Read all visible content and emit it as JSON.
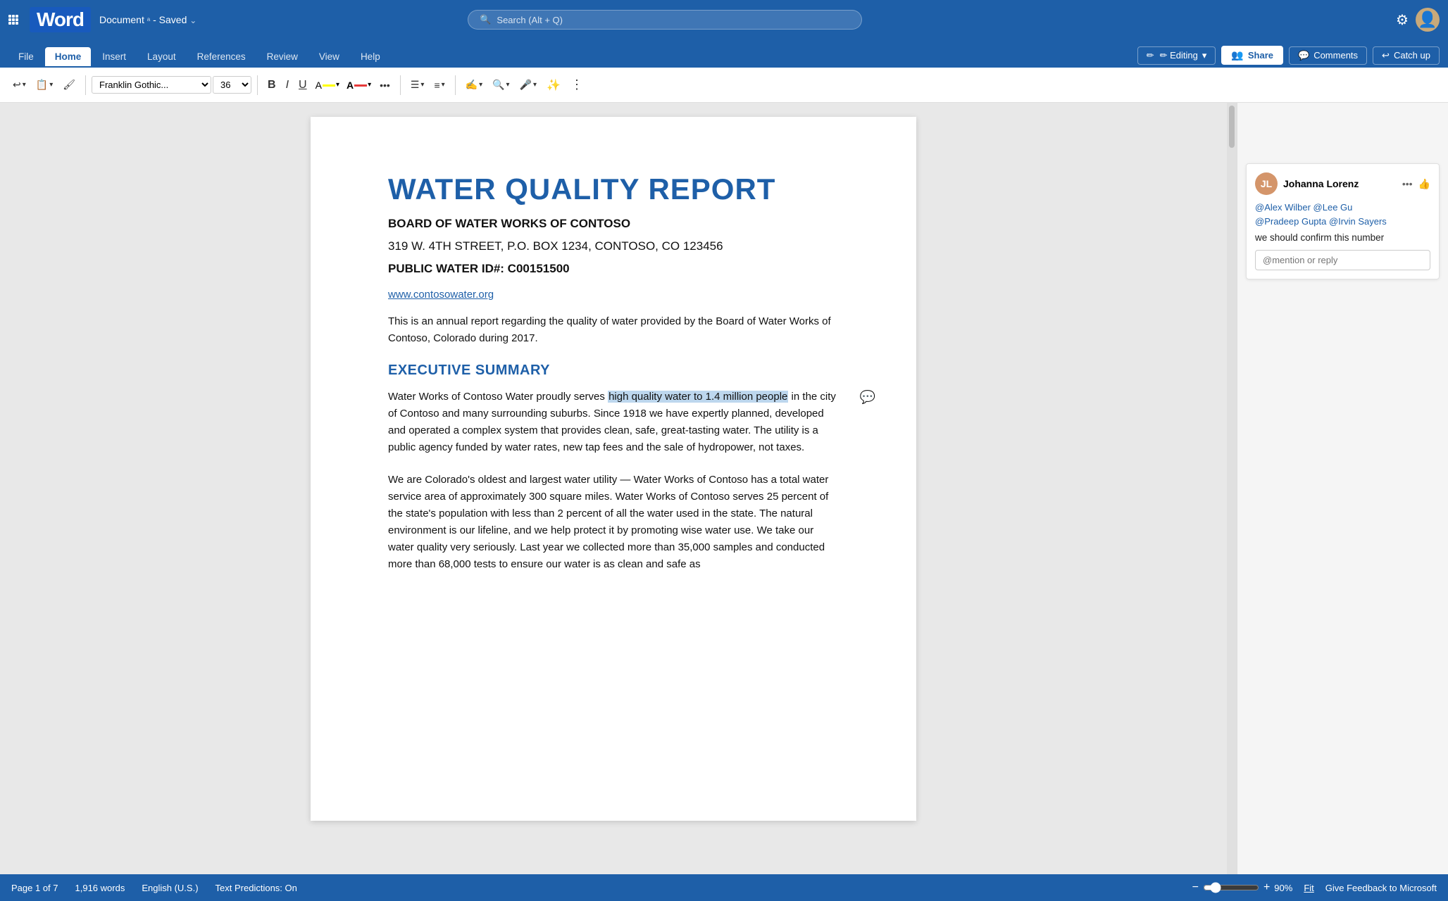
{
  "app": {
    "name": "Word",
    "logo_letter": "W"
  },
  "titlebar": {
    "document_name": "Document",
    "saved_status": "Saved",
    "search_placeholder": "Search (Alt + Q)"
  },
  "ribbon": {
    "tabs": [
      "File",
      "Home",
      "Insert",
      "Layout",
      "References",
      "Review",
      "View",
      "Help"
    ],
    "active_tab": "Home",
    "editing_label": "✏ Editing",
    "share_label": "Share",
    "comments_label": "Comments",
    "catchup_label": "Catch up"
  },
  "toolbar": {
    "undo_label": "↩",
    "clipboard_label": "📋",
    "font_name": "Franklin Gothic...",
    "font_size": "36",
    "bold": "B",
    "italic": "I",
    "underline": "U",
    "more_label": "•••",
    "bullets_label": "☰",
    "align_label": "≡",
    "editor_label": "✍",
    "search_label": "🔍",
    "dictate_label": "🎤",
    "copilot_label": "✨",
    "overflow_label": "•••"
  },
  "document": {
    "title": "WATER QUALITY REPORT",
    "subtitle": "BOARD OF WATER WORKS OF CONTOSO",
    "address": "319 W. 4TH STREET, P.O. BOX 1234, CONTOSO, CO 123456",
    "public_id": "PUBLIC WATER ID#: C00151500",
    "website": "www.contosowater.org",
    "intro": "This is an annual report regarding the quality of water provided by the Board of Water Works of Contoso, Colorado during 2017.",
    "section1_heading": "EXECUTIVE SUMMARY",
    "section1_p1_before": "Water Works of Contoso Water proudly serves ",
    "section1_p1_highlighted": "high quality water to 1.4 million people",
    "section1_p1_after": " in the city of Contoso and many surrounding suburbs. Since 1918 we have expertly planned, developed and operated a complex system that provides clean, safe, great-tasting water. The utility is a public agency funded by water rates, new tap fees and the sale of hydropower, not taxes.",
    "section1_p2": "We are Colorado's oldest and largest water utility — Water Works of Contoso has a total water service area of approximately 300 square miles. Water Works of Contoso serves 25 percent of the state's population with less than 2 percent of all the water used in the state. The natural environment is our lifeline, and we help protect it by promoting wise water use. We take our water quality very seriously. Last year we collected more than 35,000 samples and conducted more than 68,000 tests to ensure our water is as clean and safe as"
  },
  "comment": {
    "author": "Johanna Lorenz",
    "avatar_initials": "JL",
    "mentions": "@Alex Wilber  @Lee Gu\n@Pradeep Gupta  @Irvin Sayers",
    "text": "we should confirm this number",
    "reply_placeholder": "@mention or reply"
  },
  "statusbar": {
    "page_info": "Page 1 of 7",
    "word_count": "1,916 words",
    "language": "English (U.S.)",
    "text_predictions": "Text Predictions: On",
    "zoom_level": "90%",
    "fit_label": "Fit",
    "feedback_label": "Give Feedback to Microsoft"
  }
}
